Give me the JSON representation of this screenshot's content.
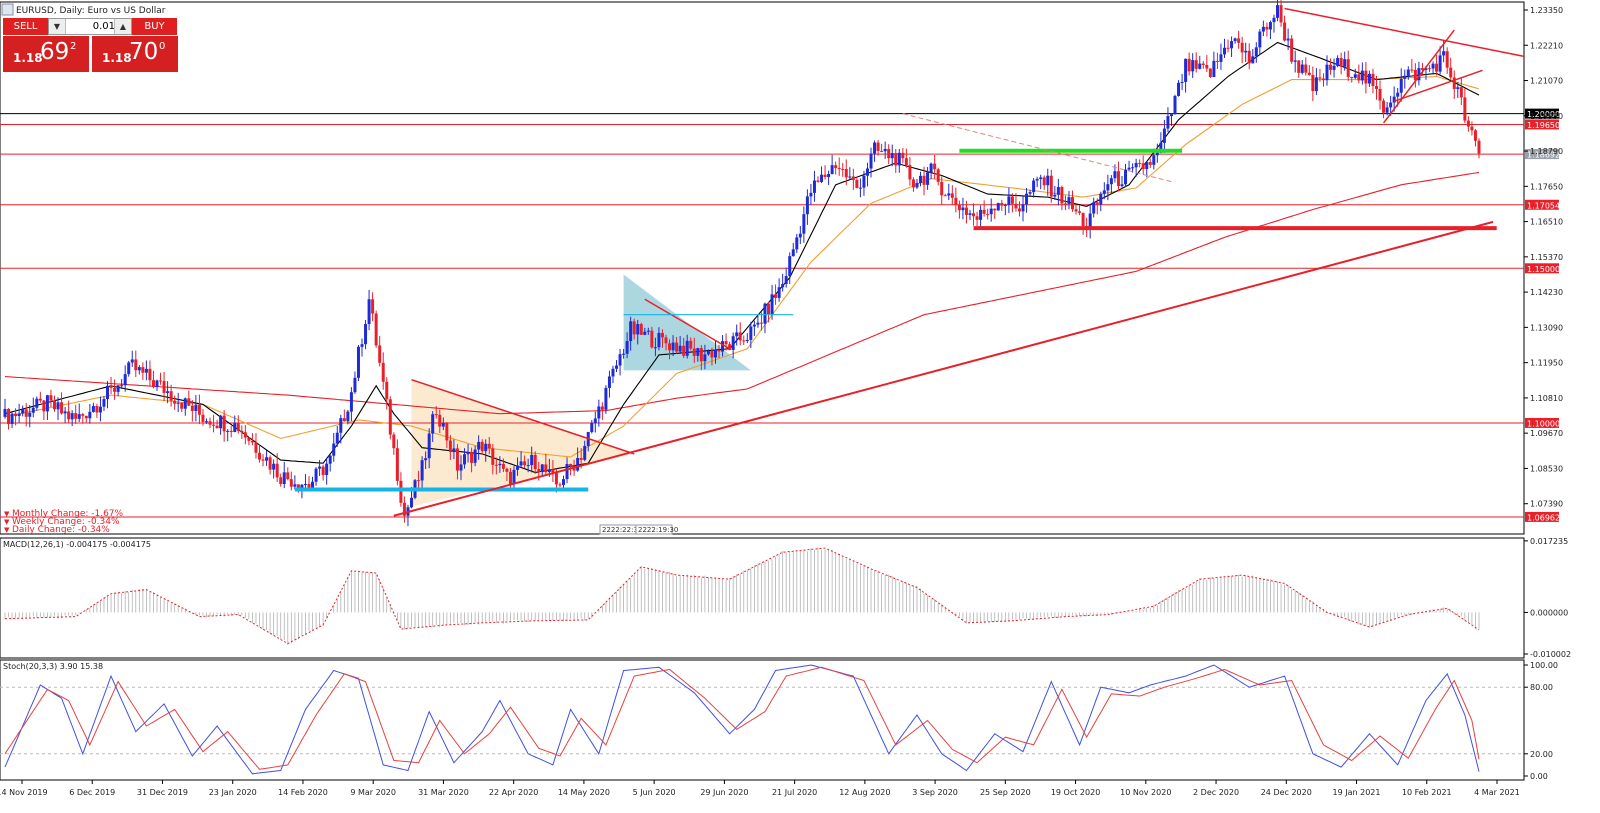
{
  "chart_title": "EURUSD, Daily:  Euro vs US Dollar",
  "trade_panel": {
    "sell_label": "SELL",
    "buy_label": "BUY",
    "lot_value": "0.01",
    "sell_price_small": "1.18",
    "sell_price_big": "69",
    "sell_price_sup": "2",
    "buy_price_small": "1.18",
    "buy_price_big": "70",
    "buy_price_sup": "0"
  },
  "change_info": {
    "monthly": "Monthly Change: -1.67%",
    "weekly": "Weekly Change: -0.34%",
    "daily": "Daily Change: -0.34%"
  },
  "session_labels": [
    "2222:22:30",
    "2222:19:30"
  ],
  "colors": {
    "bull": "#1f2bd6",
    "bear": "#e8202a",
    "level_line": "#e8202a",
    "ma_fast": "#000000",
    "ma_mid": "#f2a030",
    "ma_slow": "#e8202a",
    "support_cyan": "#14b4e6",
    "support_green": "#22dd22",
    "stoch_main": "#4050e0",
    "stoch_signal": "#e84040"
  },
  "chart_data": [
    {
      "type": "candlestick",
      "panel": "price",
      "symbol": "EURUSD",
      "timeframe": "Daily",
      "ylim": [
        1.0696,
        1.2335
      ],
      "y_ticks": [
        "1.23350",
        "1.22210",
        "1.21070",
        "1.19930",
        "1.18790",
        "1.17650",
        "1.16510",
        "1.15370",
        "1.14230",
        "1.13090",
        "1.11950",
        "1.10810",
        "1.09670",
        "1.08530",
        "1.07390"
      ],
      "x_ticks": [
        "14 Nov 2019",
        "6 Dec 2019",
        "31 Dec 2019",
        "23 Jan 2020",
        "14 Feb 2020",
        "9 Mar 2020",
        "31 Mar 2020",
        "22 Apr 2020",
        "14 May 2020",
        "5 Jun 2020",
        "29 Jun 2020",
        "21 Jul 2020",
        "12 Aug 2020",
        "3 Sep 2020",
        "25 Sep 2020",
        "19 Oct 2020",
        "10 Nov 2020",
        "2 Dec 2020",
        "24 Dec 2020",
        "19 Jan 2021",
        "10 Feb 2021",
        "4 Mar 2021"
      ],
      "price_anchors": [
        [
          0,
          1.102
        ],
        [
          12,
          1.106
        ],
        [
          20,
          1.101
        ],
        [
          30,
          1.11
        ],
        [
          36,
          1.118
        ],
        [
          45,
          1.111
        ],
        [
          56,
          1.102
        ],
        [
          66,
          1.099
        ],
        [
          78,
          1.083
        ],
        [
          86,
          1.08
        ],
        [
          92,
          1.088
        ],
        [
          98,
          1.11
        ],
        [
          103,
          1.14
        ],
        [
          108,
          1.105
        ],
        [
          113,
          1.07
        ],
        [
          118,
          1.085
        ],
        [
          122,
          1.105
        ],
        [
          128,
          1.086
        ],
        [
          135,
          1.093
        ],
        [
          142,
          1.082
        ],
        [
          150,
          1.088
        ],
        [
          156,
          1.08
        ],
        [
          163,
          1.09
        ],
        [
          170,
          1.11
        ],
        [
          177,
          1.13
        ],
        [
          184,
          1.127
        ],
        [
          190,
          1.125
        ],
        [
          197,
          1.122
        ],
        [
          205,
          1.125
        ],
        [
          212,
          1.13
        ],
        [
          220,
          1.145
        ],
        [
          228,
          1.175
        ],
        [
          235,
          1.184
        ],
        [
          241,
          1.176
        ],
        [
          246,
          1.188
        ],
        [
          252,
          1.186
        ],
        [
          257,
          1.178
        ],
        [
          262,
          1.181
        ],
        [
          268,
          1.172
        ],
        [
          275,
          1.166
        ],
        [
          281,
          1.172
        ],
        [
          287,
          1.17
        ],
        [
          293,
          1.179
        ],
        [
          300,
          1.172
        ],
        [
          306,
          1.164
        ],
        [
          312,
          1.178
        ],
        [
          318,
          1.18
        ],
        [
          326,
          1.186
        ],
        [
          334,
          1.215
        ],
        [
          341,
          1.213
        ],
        [
          347,
          1.225
        ],
        [
          352,
          1.217
        ],
        [
          357,
          1.229
        ],
        [
          360,
          1.233
        ],
        [
          364,
          1.219
        ],
        [
          370,
          1.208
        ],
        [
          376,
          1.216
        ],
        [
          382,
          1.214
        ],
        [
          386,
          1.21
        ],
        [
          390,
          1.202
        ],
        [
          396,
          1.212
        ],
        [
          402,
          1.214
        ],
        [
          407,
          1.218
        ],
        [
          411,
          1.207
        ],
        [
          414,
          1.195
        ],
        [
          417,
          1.187
        ]
      ],
      "ma_fast_anchors": [
        [
          0,
          1.103
        ],
        [
          30,
          1.112
        ],
        [
          56,
          1.106
        ],
        [
          78,
          1.088
        ],
        [
          90,
          1.087
        ],
        [
          98,
          1.099
        ],
        [
          105,
          1.112
        ],
        [
          110,
          1.103
        ],
        [
          118,
          1.092
        ],
        [
          135,
          1.09
        ],
        [
          150,
          1.084
        ],
        [
          165,
          1.087
        ],
        [
          175,
          1.106
        ],
        [
          185,
          1.122
        ],
        [
          205,
          1.124
        ],
        [
          222,
          1.147
        ],
        [
          235,
          1.177
        ],
        [
          252,
          1.184
        ],
        [
          265,
          1.18
        ],
        [
          278,
          1.174
        ],
        [
          295,
          1.173
        ],
        [
          306,
          1.17
        ],
        [
          318,
          1.177
        ],
        [
          332,
          1.198
        ],
        [
          346,
          1.212
        ],
        [
          360,
          1.223
        ],
        [
          372,
          1.218
        ],
        [
          388,
          1.211
        ],
        [
          405,
          1.213
        ],
        [
          417,
          1.206
        ]
      ],
      "ma_mid_anchors": [
        [
          0,
          1.102
        ],
        [
          30,
          1.109
        ],
        [
          56,
          1.106
        ],
        [
          78,
          1.095
        ],
        [
          100,
          1.101
        ],
        [
          115,
          1.099
        ],
        [
          135,
          1.092
        ],
        [
          160,
          1.089
        ],
        [
          175,
          1.099
        ],
        [
          190,
          1.116
        ],
        [
          210,
          1.124
        ],
        [
          228,
          1.152
        ],
        [
          245,
          1.171
        ],
        [
          262,
          1.179
        ],
        [
          285,
          1.176
        ],
        [
          305,
          1.173
        ],
        [
          320,
          1.176
        ],
        [
          334,
          1.19
        ],
        [
          350,
          1.203
        ],
        [
          364,
          1.211
        ],
        [
          386,
          1.211
        ],
        [
          405,
          1.212
        ],
        [
          417,
          1.208
        ]
      ],
      "ma_slow_anchors": [
        [
          0,
          1.115
        ],
        [
          40,
          1.112
        ],
        [
          80,
          1.109
        ],
        [
          110,
          1.106
        ],
        [
          140,
          1.103
        ],
        [
          170,
          1.104
        ],
        [
          190,
          1.108
        ],
        [
          210,
          1.111
        ],
        [
          235,
          1.123
        ],
        [
          260,
          1.135
        ],
        [
          290,
          1.142
        ],
        [
          320,
          1.149
        ],
        [
          345,
          1.16
        ],
        [
          370,
          1.169
        ],
        [
          395,
          1.177
        ],
        [
          417,
          1.181
        ]
      ],
      "horizontal_levels": [
        {
          "price": 1.2,
          "label": "1.20000",
          "label_color": "#000000"
        },
        {
          "price": 1.1965,
          "label": "1.19650",
          "label_color": "#e8202a"
        },
        {
          "price": 1.18692,
          "label": "1.18692",
          "label_color": "#9aa0a8"
        },
        {
          "price": 1.17054,
          "label": "1.17054",
          "label_color": "#e8202a"
        },
        {
          "price": 1.15,
          "label": "1.15000",
          "label_color": "#e8202a"
        },
        {
          "price": 1.1,
          "label": "1.10000",
          "label_color": "#e8202a"
        },
        {
          "price": 1.06962,
          "label": "1.06962",
          "label_color": "#e8202a"
        }
      ],
      "support_zones": [
        {
          "from": 82,
          "to": 165,
          "price": 1.0785,
          "color": "#14b4e6"
        },
        {
          "from": 270,
          "to": 333,
          "price": 1.188,
          "color": "#22dd22"
        },
        {
          "from": 274,
          "to": 422,
          "price": 1.163,
          "color": "#e8202a"
        }
      ],
      "trendlines": [
        {
          "from": [
            110,
            1.07
          ],
          "to": [
            421,
            1.165
          ]
        },
        {
          "from": [
            115,
            1.114
          ],
          "to": [
            178,
            1.09
          ]
        },
        {
          "from": [
            181,
            1.14
          ],
          "to": [
            205,
            1.124
          ]
        },
        {
          "from": [
            362,
            1.234
          ],
          "to": [
            432,
            1.2185
          ]
        },
        {
          "from": [
            390,
            1.197
          ],
          "to": [
            410,
            1.227
          ]
        },
        {
          "from": [
            393,
            1.204
          ],
          "to": [
            418,
            1.214
          ]
        }
      ],
      "shaded_triangles": [
        {
          "points": [
            [
              115,
              1.114
            ],
            [
              115,
              1.073
            ],
            [
              178,
              1.09
            ]
          ],
          "color": "#fbe6c8"
        },
        {
          "points": [
            [
              175,
              1.148
            ],
            [
              175,
              1.117
            ],
            [
              211,
              1.117
            ]
          ],
          "color": "#9ed0dc"
        }
      ],
      "channel_box": {
        "from": [
          175,
          1.135
        ],
        "to": [
          223,
          1.135
        ]
      },
      "dashed_line": {
        "from": [
          254,
          1.2
        ],
        "to": [
          330,
          1.178
        ]
      }
    },
    {
      "type": "bar",
      "panel": "MACD",
      "label": "MACD(12,26,1) -0.004175 -0.004175",
      "ylim": [
        -0.01,
        0.0172
      ],
      "y_ticks": [
        "0.017235",
        "0.000000",
        "-0.010002"
      ],
      "anchors": [
        [
          0,
          -0.0015
        ],
        [
          20,
          -0.001
        ],
        [
          30,
          0.0045
        ],
        [
          40,
          0.0055
        ],
        [
          55,
          -0.001
        ],
        [
          66,
          -0.0005
        ],
        [
          80,
          -0.0075
        ],
        [
          90,
          -0.003
        ],
        [
          98,
          0.01
        ],
        [
          105,
          0.0095
        ],
        [
          112,
          -0.004
        ],
        [
          125,
          -0.003
        ],
        [
          135,
          -0.0025
        ],
        [
          150,
          -0.002
        ],
        [
          165,
          -0.0018
        ],
        [
          180,
          0.011
        ],
        [
          190,
          0.009
        ],
        [
          205,
          0.008
        ],
        [
          220,
          0.0145
        ],
        [
          232,
          0.0155
        ],
        [
          245,
          0.0105
        ],
        [
          258,
          0.006
        ],
        [
          272,
          -0.0025
        ],
        [
          285,
          -0.002
        ],
        [
          300,
          -0.001
        ],
        [
          312,
          -0.0005
        ],
        [
          325,
          0.0015
        ],
        [
          338,
          0.008
        ],
        [
          350,
          0.009
        ],
        [
          362,
          0.007
        ],
        [
          374,
          0.0
        ],
        [
          386,
          -0.0035
        ],
        [
          397,
          -0.0005
        ],
        [
          408,
          0.001
        ],
        [
          417,
          -0.0042
        ]
      ]
    },
    {
      "type": "line",
      "panel": "Stochastic",
      "label": "Stoch(20,3,3) 3.90 15.38",
      "ylim": [
        0,
        100
      ],
      "y_ticks": [
        "100.00",
        "80.00",
        "20.00",
        "0.00"
      ],
      "series_main_anchors": [
        [
          0,
          8
        ],
        [
          10,
          82
        ],
        [
          16,
          70
        ],
        [
          22,
          20
        ],
        [
          30,
          90
        ],
        [
          37,
          40
        ],
        [
          45,
          65
        ],
        [
          53,
          18
        ],
        [
          60,
          45
        ],
        [
          70,
          2
        ],
        [
          78,
          5
        ],
        [
          85,
          60
        ],
        [
          93,
          95
        ],
        [
          100,
          88
        ],
        [
          107,
          10
        ],
        [
          114,
          5
        ],
        [
          120,
          58
        ],
        [
          127,
          12
        ],
        [
          135,
          40
        ],
        [
          140,
          68
        ],
        [
          148,
          20
        ],
        [
          155,
          10
        ],
        [
          160,
          60
        ],
        [
          168,
          20
        ],
        [
          175,
          95
        ],
        [
          185,
          98
        ],
        [
          195,
          75
        ],
        [
          205,
          38
        ],
        [
          212,
          60
        ],
        [
          218,
          95
        ],
        [
          228,
          100
        ],
        [
          240,
          90
        ],
        [
          250,
          20
        ],
        [
          258,
          55
        ],
        [
          265,
          20
        ],
        [
          272,
          5
        ],
        [
          280,
          38
        ],
        [
          288,
          22
        ],
        [
          296,
          85
        ],
        [
          304,
          28
        ],
        [
          310,
          80
        ],
        [
          318,
          75
        ],
        [
          324,
          82
        ],
        [
          334,
          90
        ],
        [
          342,
          100
        ],
        [
          352,
          80
        ],
        [
          362,
          90
        ],
        [
          370,
          20
        ],
        [
          378,
          8
        ],
        [
          386,
          38
        ],
        [
          394,
          10
        ],
        [
          402,
          68
        ],
        [
          408,
          92
        ],
        [
          413,
          55
        ],
        [
          417,
          4
        ]
      ],
      "series_signal_anchors": [
        [
          0,
          20
        ],
        [
          12,
          78
        ],
        [
          18,
          68
        ],
        [
          24,
          28
        ],
        [
          32,
          85
        ],
        [
          40,
          45
        ],
        [
          48,
          60
        ],
        [
          56,
          22
        ],
        [
          63,
          40
        ],
        [
          72,
          6
        ],
        [
          80,
          10
        ],
        [
          88,
          55
        ],
        [
          96,
          92
        ],
        [
          102,
          85
        ],
        [
          110,
          14
        ],
        [
          117,
          12
        ],
        [
          123,
          50
        ],
        [
          130,
          20
        ],
        [
          137,
          38
        ],
        [
          143,
          62
        ],
        [
          151,
          25
        ],
        [
          157,
          18
        ],
        [
          163,
          52
        ],
        [
          170,
          28
        ],
        [
          178,
          90
        ],
        [
          188,
          96
        ],
        [
          198,
          70
        ],
        [
          207,
          42
        ],
        [
          215,
          58
        ],
        [
          221,
          90
        ],
        [
          231,
          98
        ],
        [
          243,
          86
        ],
        [
          252,
          28
        ],
        [
          261,
          50
        ],
        [
          268,
          24
        ],
        [
          275,
          12
        ],
        [
          283,
          35
        ],
        [
          291,
          28
        ],
        [
          299,
          78
        ],
        [
          306,
          35
        ],
        [
          313,
          74
        ],
        [
          321,
          72
        ],
        [
          328,
          80
        ],
        [
          337,
          88
        ],
        [
          345,
          96
        ],
        [
          355,
          82
        ],
        [
          364,
          86
        ],
        [
          373,
          28
        ],
        [
          381,
          14
        ],
        [
          389,
          36
        ],
        [
          397,
          16
        ],
        [
          405,
          62
        ],
        [
          410,
          86
        ],
        [
          415,
          50
        ],
        [
          417,
          15
        ]
      ]
    }
  ]
}
